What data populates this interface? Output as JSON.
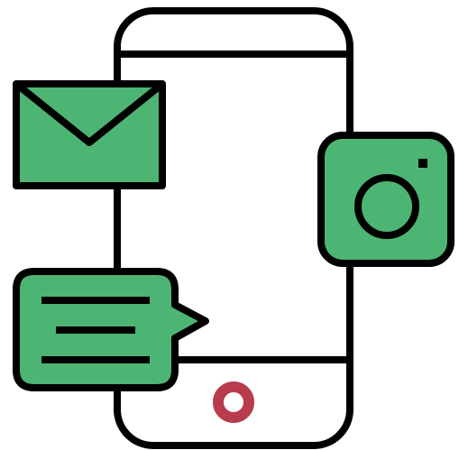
{
  "illustration": {
    "subject": "smartphone-with-social-icons",
    "icons": [
      "smartphone-icon",
      "envelope-icon",
      "camera-icon",
      "chat-bubble-icon",
      "home-button-icon"
    ],
    "colors": {
      "outline": "#000000",
      "fill_green": "#4db573",
      "screen": "#ffffff",
      "home_button": "#b83c4e"
    }
  }
}
